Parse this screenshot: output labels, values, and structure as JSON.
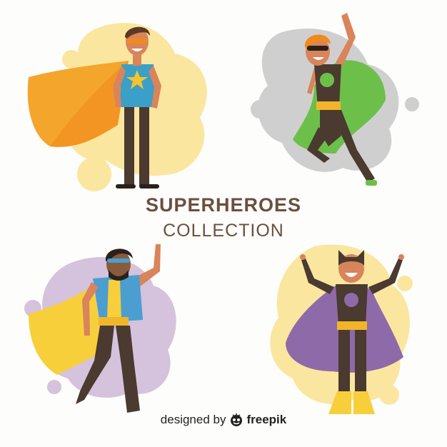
{
  "title": "SUPERHEROES",
  "subtitle": "COLLECTION",
  "credit": {
    "prefix": "designed by",
    "brand": "freepik",
    "icon": "freepik-logo-icon"
  },
  "heroes": [
    {
      "name": "hero-orange-cape",
      "cape_color": "#f4a52c",
      "blob_color": "#fbe6a0",
      "shirt_color": "#3aa0c8",
      "emblem": "star"
    },
    {
      "name": "hero-green-cape",
      "cape_color": "#6cc04a",
      "blob_color": "#cfcfcf",
      "suit_color": "#4a3a30"
    },
    {
      "name": "hero-yellow-cape",
      "cape_color": "#f7cf3a",
      "blob_color": "#d5c2dc",
      "shirt_color": "#4a9ed0"
    },
    {
      "name": "hero-purple-cape",
      "cape_color": "#8e6aa8",
      "blob_color": "#fbe6a0",
      "suit_color": "#4a3a30"
    }
  ],
  "colors": {
    "background": "#fdfdfb",
    "title_text": "#6b4f3f",
    "skin": "#d9845a",
    "belt": "#f0b52a",
    "pants": "#4a3a30"
  }
}
